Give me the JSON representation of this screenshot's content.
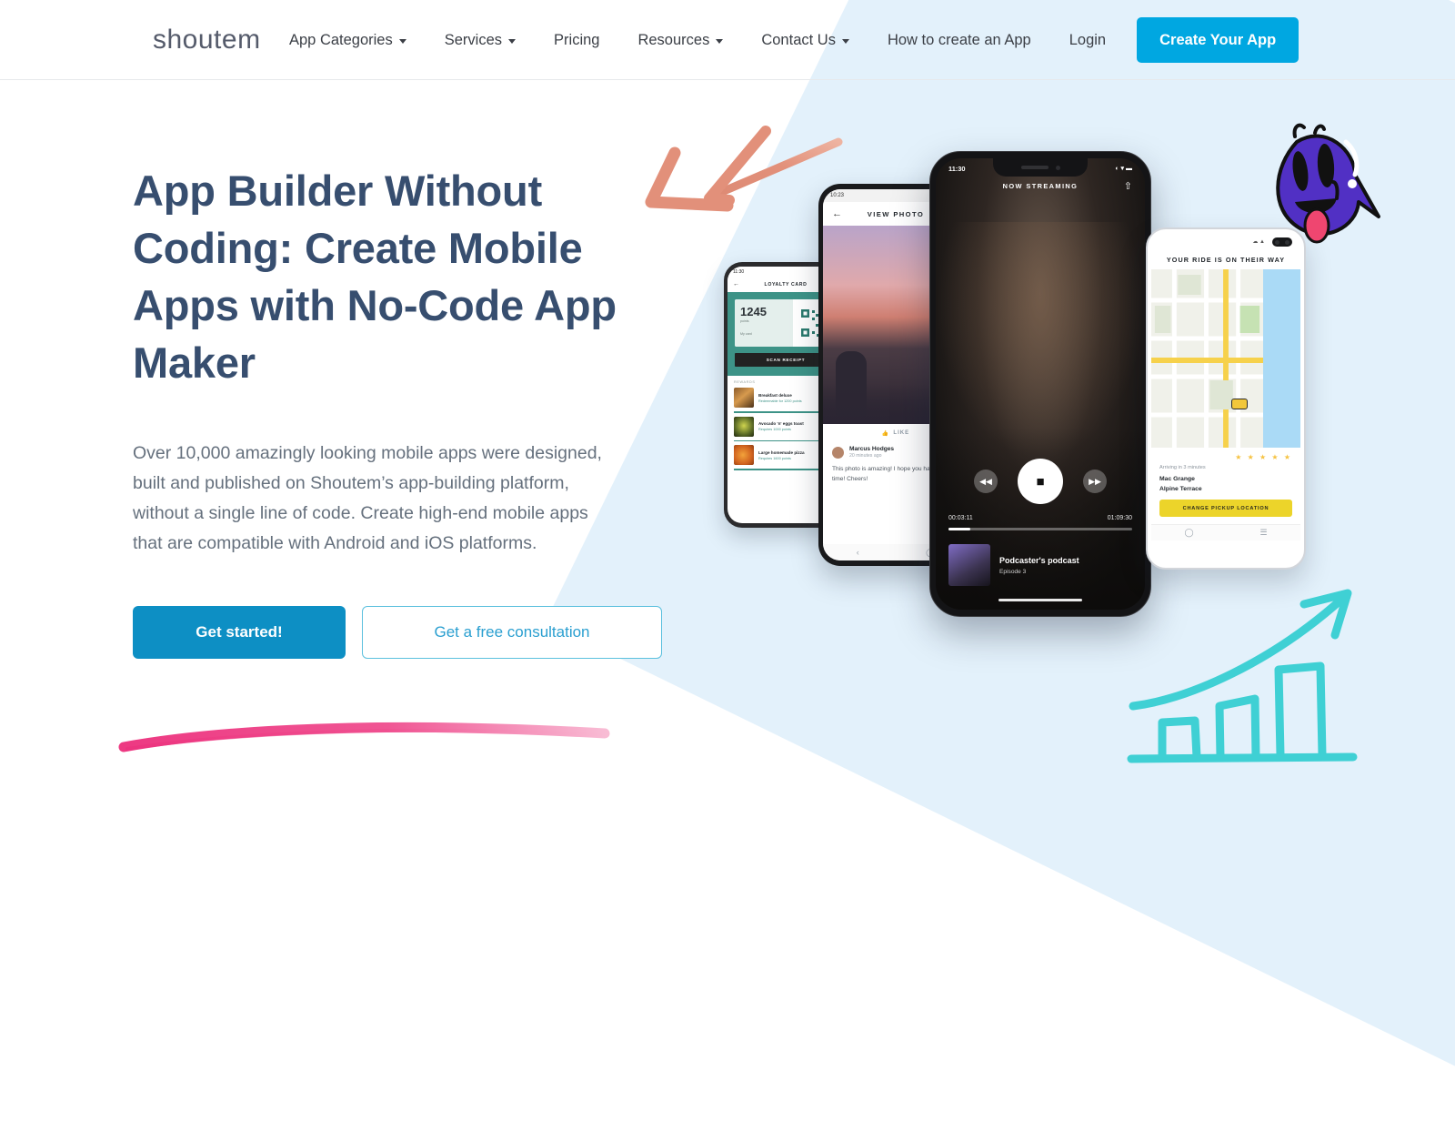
{
  "brand": {
    "logo_text": "shoutem",
    "accent_color": "#00a7e1",
    "headline_color": "#374e6f"
  },
  "header": {
    "nav_items": [
      {
        "label": "App Categories",
        "has_dropdown": true
      },
      {
        "label": "Services",
        "has_dropdown": true
      },
      {
        "label": "Pricing",
        "has_dropdown": false
      },
      {
        "label": "Resources",
        "has_dropdown": true
      },
      {
        "label": "Contact Us",
        "has_dropdown": true
      },
      {
        "label": "How to create an App",
        "has_dropdown": false
      }
    ],
    "login_label": "Login",
    "cta_label": "Create Your App"
  },
  "hero": {
    "heading": "App Builder Without Coding: Create Mobile Apps with No-Code App Maker",
    "paragraph": "Over 10,000 amazingly looking mobile apps were designed, built and published on Shoutem’s app-building platform, without a single line of code. Create high-end mobile apps that are compatible with Android and iOS platforms.",
    "primary_cta": "Get started!",
    "secondary_cta": "Get a free consultation"
  },
  "decorations": {
    "coral_arrow_color": "#e2907a",
    "pink_brush_color": "#ed3d7d",
    "teal_chart_color": "#3fd0d4",
    "mascot_color": "#5game"
  },
  "phones": {
    "loyalty": {
      "status_time": "11:30",
      "screen_title": "LOYALTY CARD",
      "points_value": "1245",
      "points_label": "points",
      "card_label": "My card",
      "scan_button": "SCAN RECEIPT",
      "list_header": "REWARDS",
      "items": [
        {
          "name": "Breakfast deluxe",
          "meta": "Redeemable for 1200 points"
        },
        {
          "name": "Avocado 'n' eggs toast",
          "meta": "Requires 1000 points"
        },
        {
          "name": "Large homemade pizza",
          "meta": "Requires 1600 points"
        }
      ]
    },
    "photo": {
      "status_time": "10:23",
      "screen_title": "VIEW PHOTO",
      "back_icon": "back-arrow-icon",
      "like_label": "LIKE",
      "comment_author": "Marcus Hodges",
      "comment_time": "20 minutes ago",
      "comment_text": "This photo is amazing! I hope you had a great time! Cheers!"
    },
    "podcast": {
      "status_time": "11:30",
      "header_label": "NOW STREAMING",
      "share_icon": "share-icon",
      "rewind_icon": "rewind-icon",
      "stop_icon": "stop-icon",
      "forward_icon": "fast-forward-icon",
      "elapsed": "00:03:11",
      "duration": "01:09:30",
      "track_title": "Podcaster's podcast",
      "track_subtitle": "Episode 3"
    },
    "map": {
      "screen_title": "YOUR RIDE IS ON THEIR WAY",
      "rating": "★ ★ ★ ★ ★",
      "eta_text": "Arriving in 3 minutes",
      "line1": "Mac Grange",
      "line2": "Alpine Terrace",
      "action_button": "CHANGE PICKUP LOCATION",
      "vehicle_icon": "taxi-icon"
    }
  }
}
